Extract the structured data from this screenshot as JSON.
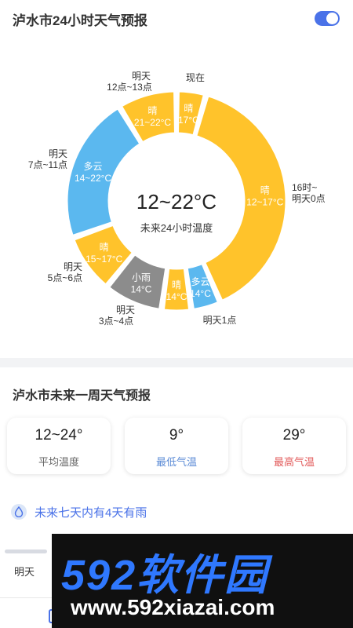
{
  "header": {
    "title": "泸水市24小时天气预报",
    "toggle_on": true
  },
  "colors": {
    "sunny": "#ffc32b",
    "cloudy": "#5bb8ef",
    "rain": "#8c8c8c",
    "accent": "#4a72e8",
    "low": "#5b8bd6",
    "high": "#e25a5a"
  },
  "chart_data": {
    "type": "donut",
    "center_value": "12~22°C",
    "center_label": "未来24小时温度",
    "segments": [
      {
        "weather": "晴",
        "temp": "17°C",
        "time_label": "现在",
        "hours": 1
      },
      {
        "weather": "晴",
        "temp": "12~17°C",
        "time_label": "16时~明天0点",
        "hours": 9
      },
      {
        "weather": "多云",
        "temp": "14°C",
        "time_label": "明天1点",
        "hours": 1
      },
      {
        "weather": "晴",
        "temp": "14°C",
        "time_label": "",
        "hours": 1
      },
      {
        "weather": "小雨",
        "temp": "14°C",
        "time_label": "明天3点~4点",
        "hours": 2
      },
      {
        "weather": "晴",
        "temp": "15~17°C",
        "time_label": "明天5点~6点",
        "hours": 2
      },
      {
        "weather": "多云",
        "temp": "14~22°C",
        "time_label": "明天7点~11点",
        "hours": 5
      },
      {
        "weather": "晴",
        "temp": "21~22°C",
        "time_label": "明天12点~13点",
        "hours": 2
      }
    ],
    "outer_labels": {
      "now": "现在",
      "s1_l1": "16时~",
      "s1_l2": "明天0点",
      "s2": "明天1点",
      "s4_l1": "明天",
      "s4_l2": "3点~4点",
      "s5_l1": "明天",
      "s5_l2": "5点~6点",
      "s6_l1": "明天",
      "s6_l2": "7点~11点",
      "s7_l1": "明天",
      "s7_l2": "12点~13点"
    }
  },
  "week": {
    "title": "泸水市未来一周天气预报",
    "stats": [
      {
        "value": "12~24°",
        "label": "平均温度"
      },
      {
        "value": "9°",
        "label": "最低气温"
      },
      {
        "value": "29°",
        "label": "最高气温"
      }
    ],
    "rain_summary": "未来七天内有4天有雨",
    "first_day": "明天"
  },
  "watermark": {
    "logo": "592软件园",
    "url": "www.592xiazai.com"
  }
}
